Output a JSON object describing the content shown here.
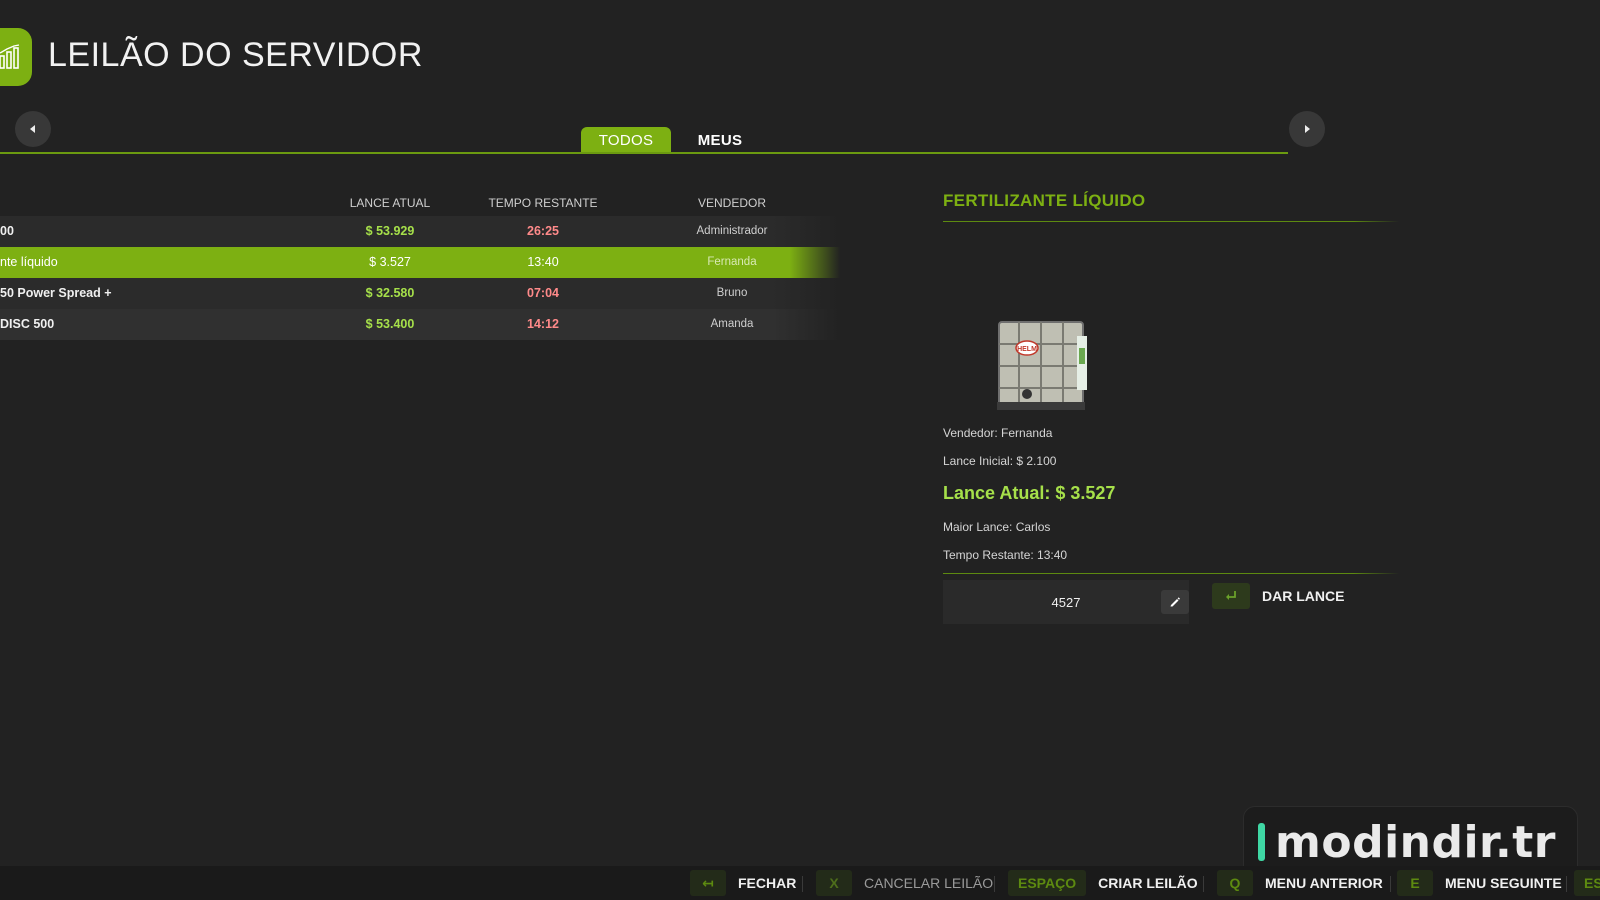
{
  "header": {
    "title": "LEILÃO DO SERVIDOR",
    "icon": "chart-bars-icon"
  },
  "tabs": [
    {
      "label": "TODOS",
      "active": true
    },
    {
      "label": "MEUS",
      "active": false
    }
  ],
  "table": {
    "columns": [
      "LANCE ATUAL",
      "TEMPO RESTANTE",
      "VENDEDOR"
    ],
    "rows": [
      {
        "name": "00",
        "bid": "$ 53.929",
        "time": "26:25",
        "seller": "Administrador",
        "selected": false
      },
      {
        "name": "nte líquido",
        "bid": "$ 3.527",
        "time": "13:40",
        "seller": "Fernanda",
        "selected": true
      },
      {
        "name": "50 Power Spread +",
        "bid": "$ 32.580",
        "time": "07:04",
        "seller": "Bruno",
        "selected": false
      },
      {
        "name": "DISC 500",
        "bid": "$ 53.400",
        "time": "14:12",
        "seller": "Amanda",
        "selected": false
      }
    ]
  },
  "detail": {
    "title": "FERTILIZANTE LÍQUIDO",
    "image_label": "HELM",
    "seller": "Vendedor: Fernanda",
    "initial_bid": "Lance Inicial: $ 2.100",
    "current_bid": "Lance Atual: $ 3.527",
    "top_bidder": "Maior Lance: Carlos",
    "time_left": "Tempo Restante: 13:40",
    "bid_input_value": "4527",
    "bid_button_label": "DAR LANCE"
  },
  "footer": [
    {
      "key": "↤",
      "label": "FECHAR",
      "enabled": true
    },
    {
      "key": "X",
      "label": "CANCELAR LEILÃO",
      "enabled": false
    },
    {
      "key": "ESPAÇO",
      "label": "CRIAR LEILÃO",
      "enabled": true
    },
    {
      "key": "Q",
      "label": "MENU ANTERIOR",
      "enabled": true
    },
    {
      "key": "E",
      "label": "MENU SEGUINTE",
      "enabled": true
    },
    {
      "key": "ES",
      "label": "",
      "enabled": true
    }
  ],
  "watermark": "modindir.tr",
  "colors": {
    "accent": "#7db012",
    "bid_green": "#a6e04a",
    "time_red": "#ff8a8a",
    "background": "#222222"
  }
}
